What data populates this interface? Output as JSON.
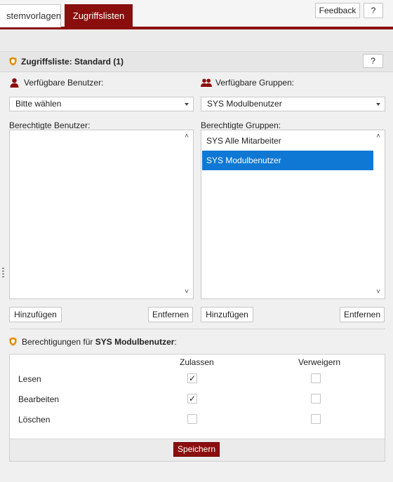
{
  "tabs": [
    {
      "label": "stemvorlagen",
      "active": false
    },
    {
      "label": "Zugriffslisten",
      "active": true
    }
  ],
  "header_buttons": {
    "feedback": "Feedback",
    "help": "?"
  },
  "section": {
    "title": "Zugriffsliste: Standard (1)",
    "help": "?"
  },
  "users": {
    "available_label": "Verfügbare Benutzer:",
    "select_value": "Bitte wählen",
    "authorized_label": "Berechtigte Benutzer:",
    "items": [],
    "add_button": "Hinzufügen",
    "remove_button": "Entfernen"
  },
  "groups": {
    "available_label": "Verfügbare Gruppen:",
    "select_value": "SYS Modulbenutzer",
    "authorized_label": "Berechtigte Gruppen:",
    "items": [
      {
        "label": "SYS Alle Mitarbeiter",
        "selected": false
      },
      {
        "label": "SYS Modulbenutzer",
        "selected": true
      }
    ],
    "add_button": "Hinzufügen",
    "remove_button": "Entfernen"
  },
  "permissions": {
    "title_prefix": "Berechtigungen für",
    "title_subject": "SYS Modulbenutzer",
    "title_suffix": ":",
    "col_allow": "Zulassen",
    "col_deny": "Verweigern",
    "rows": [
      {
        "label": "Lesen",
        "allow": true,
        "deny": false
      },
      {
        "label": "Bearbeiten",
        "allow": true,
        "deny": false
      },
      {
        "label": "Löschen",
        "allow": false,
        "deny": false
      }
    ],
    "save_button": "Speichern"
  },
  "icons": {
    "shield": "shield-icon",
    "user": "user-icon",
    "group": "group-icon",
    "dropdown": "chevron-down-icon"
  },
  "colors": {
    "brand": "#8b0e0e",
    "selection": "#0f78d4",
    "shield": "#e68a00"
  }
}
